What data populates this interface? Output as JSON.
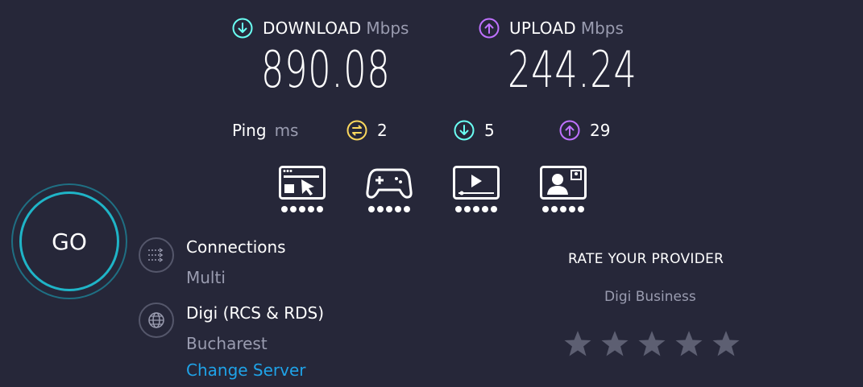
{
  "download": {
    "label": "DOWNLOAD",
    "unit": "Mbps",
    "value": "890.08",
    "icon": "download-arrow-icon"
  },
  "upload": {
    "label": "UPLOAD",
    "unit": "Mbps",
    "value": "244.24",
    "icon": "upload-arrow-icon"
  },
  "ping": {
    "label": "Ping",
    "unit": "ms",
    "idle": "2",
    "download": "5",
    "upload": "29"
  },
  "activities": [
    {
      "name": "web-browsing",
      "icon": "browser-cursor-icon",
      "rating": 5
    },
    {
      "name": "gaming",
      "icon": "gamepad-icon",
      "rating": 5
    },
    {
      "name": "streaming",
      "icon": "video-player-icon",
      "rating": 5
    },
    {
      "name": "video-chat",
      "icon": "video-call-icon",
      "rating": 5
    }
  ],
  "go": {
    "label": "GO"
  },
  "connections": {
    "title": "Connections",
    "value": "Multi",
    "icon": "connections-arrows-icon"
  },
  "server": {
    "provider": "Digi (RCS & RDS)",
    "location": "Bucharest",
    "change_label": "Change Server",
    "icon": "globe-icon"
  },
  "rating": {
    "title": "RATE YOUR PROVIDER",
    "provider": "Digi Business",
    "max_stars": 5,
    "selected": 0
  },
  "colors": {
    "background": "#262739",
    "download_accent": "#6afff3",
    "upload_accent": "#bf71ff",
    "ping_idle": "#fbd85d",
    "go_ring": "#1fb4c7",
    "link": "#1fa3e8",
    "muted": "#9a9cb0",
    "star": "#5d5f72"
  }
}
